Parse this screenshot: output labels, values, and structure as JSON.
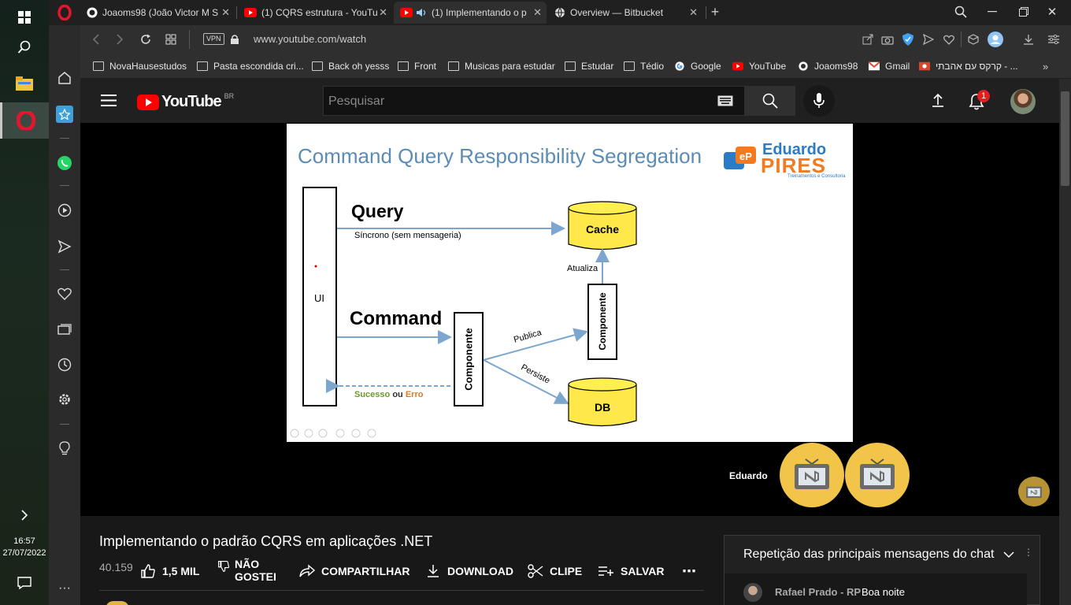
{
  "tabs": [
    {
      "label": "Joaoms98 (João Victor M S",
      "icon": "github-icon"
    },
    {
      "label": "(1) CQRS estrutura - YouTu",
      "icon": "youtube-icon"
    },
    {
      "label": "(1) Implementando o p",
      "icon": "youtube-icon",
      "active": true
    },
    {
      "label": "Overview — Bitbucket",
      "icon": "globe-icon"
    }
  ],
  "address": {
    "url": "www.youtube.com/watch",
    "vpn_label": "VPN"
  },
  "bookmarks": [
    {
      "label": "NovaHausestudos",
      "icon": "folder-icon"
    },
    {
      "label": "Pasta escondida cri...",
      "icon": "folder-icon"
    },
    {
      "label": "Back oh yesss",
      "icon": "folder-icon"
    },
    {
      "label": "Front",
      "icon": "folder-icon"
    },
    {
      "label": "Musicas para estudar",
      "icon": "folder-icon"
    },
    {
      "label": "Estudar",
      "icon": "folder-icon"
    },
    {
      "label": "Tédio",
      "icon": "folder-icon"
    },
    {
      "label": "Google",
      "icon": "google-icon"
    },
    {
      "label": "YouTube",
      "icon": "youtube-icon"
    },
    {
      "label": "Joaoms98",
      "icon": "github-icon"
    },
    {
      "label": "Gmail",
      "icon": "gmail-icon"
    },
    {
      "label": "קרקס עם אהבתי - ...",
      "icon": "site-icon"
    }
  ],
  "taskbar": {
    "time": "16:57",
    "date": "27/07/2022"
  },
  "youtube": {
    "logo_text": "YouTube",
    "country": "BR",
    "search_placeholder": "Pesquisar",
    "notifications": "1"
  },
  "slide": {
    "title": "Command Query Responsibility Segregation",
    "brand_name": "Eduardo",
    "brand_surname": "PIRES",
    "brand_tagline": "Treinamentos e Consultoria",
    "ui": "UI",
    "query": "Query",
    "query_sub": "Síncrono (sem mensageria)",
    "cache": "Cache",
    "atualiza": "Atualiza",
    "command": "Command",
    "componente1": "Componente",
    "componente2": "Componente",
    "publica": "Publica",
    "persiste": "Persiste",
    "sucesso": "Sucesso",
    "ou": "ou",
    "erro": "Erro",
    "db": "DB"
  },
  "participant": "Eduardo",
  "video": {
    "title": "Implementando o padrão CQRS em aplicações .NET",
    "views": "40.159",
    "likes": "1,5 MIL",
    "dislike_1": "NÃO",
    "dislike_2": "GOSTEI",
    "share": "COMPARTILHAR",
    "download": "DOWNLOAD",
    "clip": "CLIPE",
    "save": "SALVAR"
  },
  "chat": {
    "header": "Repetição das principais mensagens do chat",
    "author": "Rafael Prado - RP",
    "message": "Boa noite"
  }
}
